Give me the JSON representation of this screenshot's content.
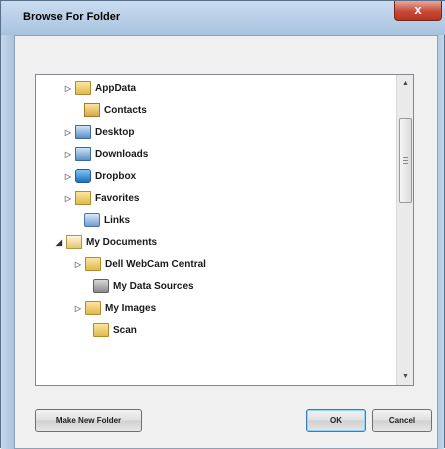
{
  "window": {
    "title": "Browse For Folder",
    "close_glyph": "x"
  },
  "tree": {
    "items": [
      {
        "label": "AppData",
        "expander": "collapsed",
        "icon": "folder-icon"
      },
      {
        "label": "Contacts",
        "expander": "none",
        "icon": "contacts-folder-icon"
      },
      {
        "label": "Desktop",
        "expander": "collapsed",
        "icon": "desktop-folder-icon"
      },
      {
        "label": "Downloads",
        "expander": "collapsed",
        "icon": "downloads-folder-icon"
      },
      {
        "label": "Dropbox",
        "expander": "collapsed",
        "icon": "dropbox-icon"
      },
      {
        "label": "Favorites",
        "expander": "collapsed",
        "icon": "favorites-folder-icon"
      },
      {
        "label": "Links",
        "expander": "none",
        "icon": "links-folder-icon"
      },
      {
        "label": "My Documents",
        "expander": "expanded",
        "icon": "documents-folder-icon"
      },
      {
        "label": "Dell WebCam Central",
        "expander": "collapsed",
        "icon": "folder-icon"
      },
      {
        "label": "My Data Sources",
        "expander": "none",
        "icon": "data-sources-icon"
      },
      {
        "label": "My Images",
        "expander": "collapsed",
        "icon": "folder-icon"
      },
      {
        "label": "Scan",
        "expander": "none",
        "icon": "folder-icon"
      }
    ],
    "expander_glyphs": {
      "collapsed": "▷",
      "expanded": "◢"
    },
    "scroll_up_glyph": "▲",
    "scroll_down_glyph": "▼"
  },
  "buttons": {
    "make_new_folder": "Make New Folder",
    "ok": "OK",
    "cancel": "Cancel"
  }
}
